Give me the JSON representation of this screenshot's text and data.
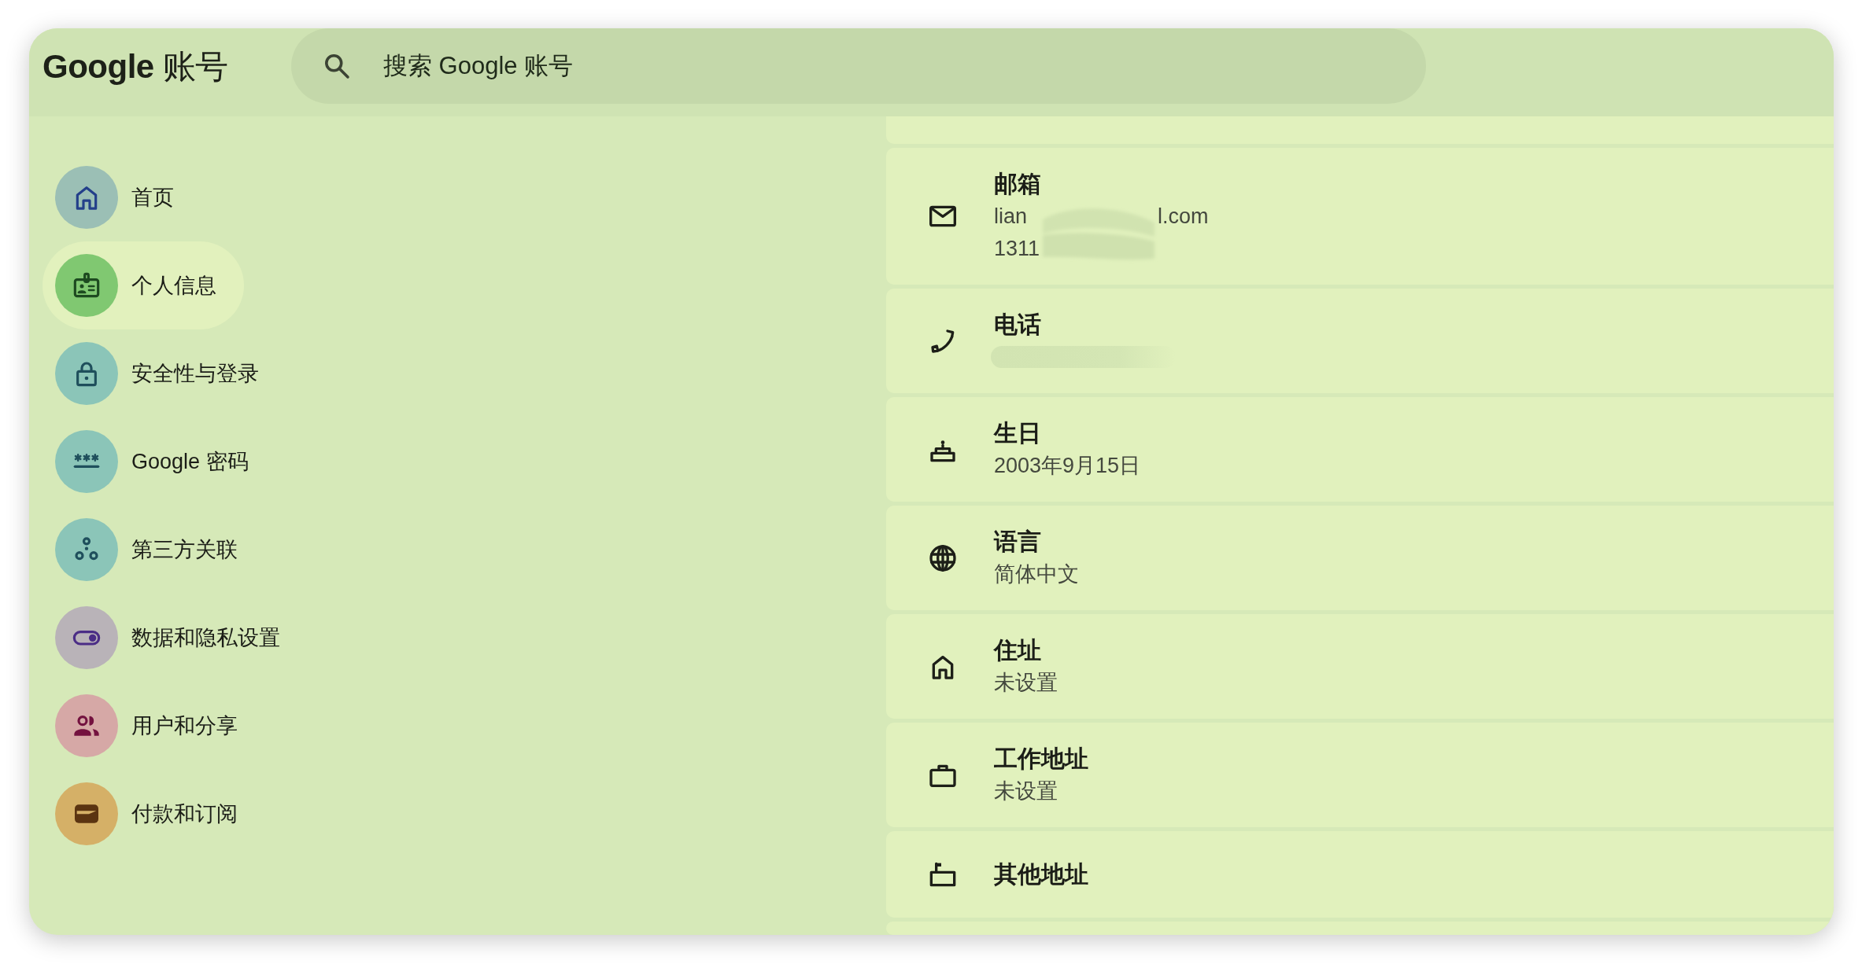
{
  "header": {
    "logo": "**Google** 账号",
    "search": {
      "placeholder": "搜索 Google 账号"
    }
  },
  "sidebar": {
    "items": [
      {
        "label": "首页",
        "color": "#9bbfb5",
        "selected": false
      },
      {
        "label": "个人信息",
        "color": "#80c871",
        "selected": true
      },
      {
        "label": "安全性与登录",
        "color": "#8bc5b8",
        "selected": false
      },
      {
        "label": "Google 密码",
        "color": "#8bc5b8",
        "selected": false
      },
      {
        "label": "第三方关联",
        "color": "#8bc5b8",
        "selected": false
      },
      {
        "label": "数据和隐私设置",
        "color": "#b9b3b8",
        "selected": false
      },
      {
        "label": "用户和分享",
        "color": "#d6a8a6",
        "selected": false
      },
      {
        "label": "付款和订阅",
        "color": "#d5b067",
        "selected": false
      }
    ]
  },
  "info_rows": [
    {
      "kind": "clipped"
    },
    {
      "kind": "detail",
      "title": "邮箱",
      "redacted": true,
      "value_lines": [
        {
          "text": "lian",
          "text_after": "l.com"
        },
        {
          "text": "1311"
        }
      ]
    },
    {
      "kind": "detail",
      "title": "电话",
      "redacted": true
    },
    {
      "kind": "detail",
      "title": "生日",
      "redacted": false,
      "value_lines": [
        {
          "text": "2003年9月15日"
        }
      ]
    },
    {
      "kind": "detail",
      "title": "语言",
      "redacted": false,
      "value_lines": [
        {
          "text": "简体中文"
        }
      ]
    },
    {
      "kind": "detail",
      "title": "住址",
      "redacted": false,
      "value_lines": [
        {
          "text": "未设置"
        }
      ]
    },
    {
      "kind": "detail",
      "title": "工作地址",
      "redacted": false,
      "value_lines": [
        {
          "text": "未设置"
        }
      ]
    },
    {
      "kind": "detail",
      "title": "其他地址",
      "redacted": false
    },
    {
      "kind": "clipped"
    }
  ]
}
